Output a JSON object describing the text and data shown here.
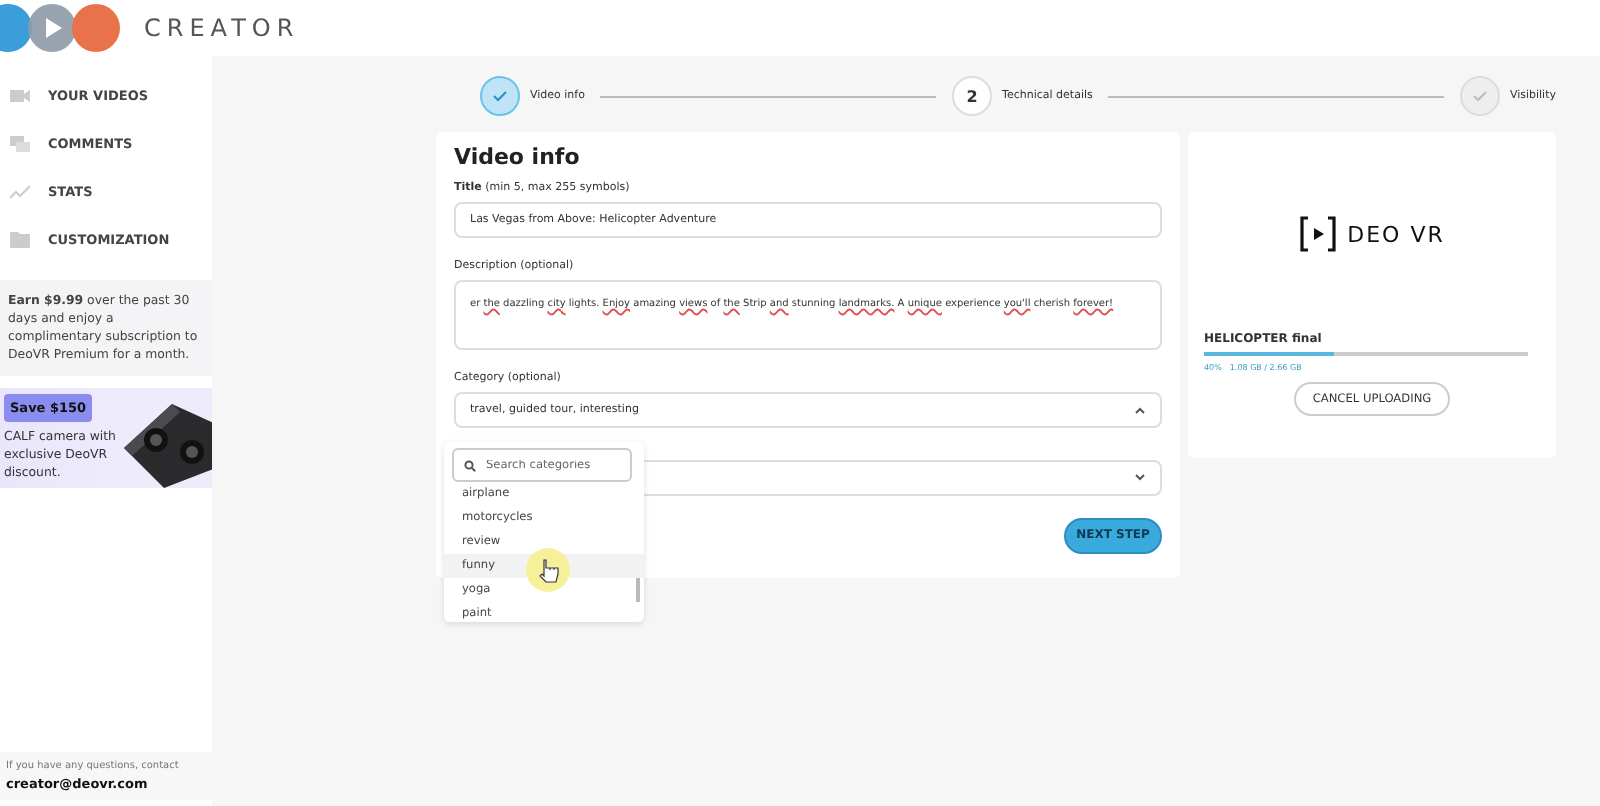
{
  "header": {
    "brand": "CREATOR"
  },
  "sidebar": {
    "items": [
      {
        "label": "YOUR VIDEOS",
        "selected": false
      },
      {
        "label": "COMMENTS",
        "selected": false
      },
      {
        "label": "STATS",
        "selected": false
      },
      {
        "label": "CUSTOMIZATION",
        "selected": false
      }
    ],
    "promo": "**Earn $9.99** over the past 30 days and enjoy a complimentary subscription to DeoVR Premium for a month.",
    "ad": {
      "badge": "Save $150",
      "text": "CALF camera with exclusive DeoVR discount."
    },
    "contact": {
      "text": "If you have any questions, contact",
      "email": "creator@deovr.com"
    }
  },
  "stepper": [
    {
      "kind": "done",
      "label": "Video info"
    },
    {
      "kind": "current",
      "number": "2",
      "label": "Technical details"
    },
    {
      "kind": "upcoming",
      "label": "Visibility"
    }
  ],
  "form": {
    "heading": "Video info",
    "title_field": {
      "label": "**Title** (min 5, max 255 symbols)",
      "value": "Las Vegas from Above: Helicopter Adventure"
    },
    "description_field": {
      "label": "Description (optional)",
      "value": "er the dazzling city lights. Enjoy amazing views of the Strip and stunning landmarks. A unique experience you'll cherish forever!"
    },
    "category_field": {
      "label": "Category (optional)",
      "value": "travel, guided tour, interesting",
      "expanded": true
    },
    "second_select": {
      "expanded": false
    },
    "dropdown": {
      "search_placeholder": "Search categories",
      "options": [
        {
          "label": "airplane",
          "selected": false
        },
        {
          "label": "motorcycles",
          "selected": false
        },
        {
          "label": "review",
          "selected": false
        },
        {
          "label": "funny",
          "selected": true
        },
        {
          "label": "yoga",
          "selected": false
        },
        {
          "label": "paint",
          "selected": false
        }
      ]
    },
    "next_button": "NEXT STEP"
  },
  "upload": {
    "logo_text": "DEO VR",
    "file_name": "HELICOPTER final",
    "level": 0.4,
    "percent": "40%",
    "size": "1.08 GB / 2.66 GB",
    "cancel_button": "CANCEL UPLOADING"
  }
}
